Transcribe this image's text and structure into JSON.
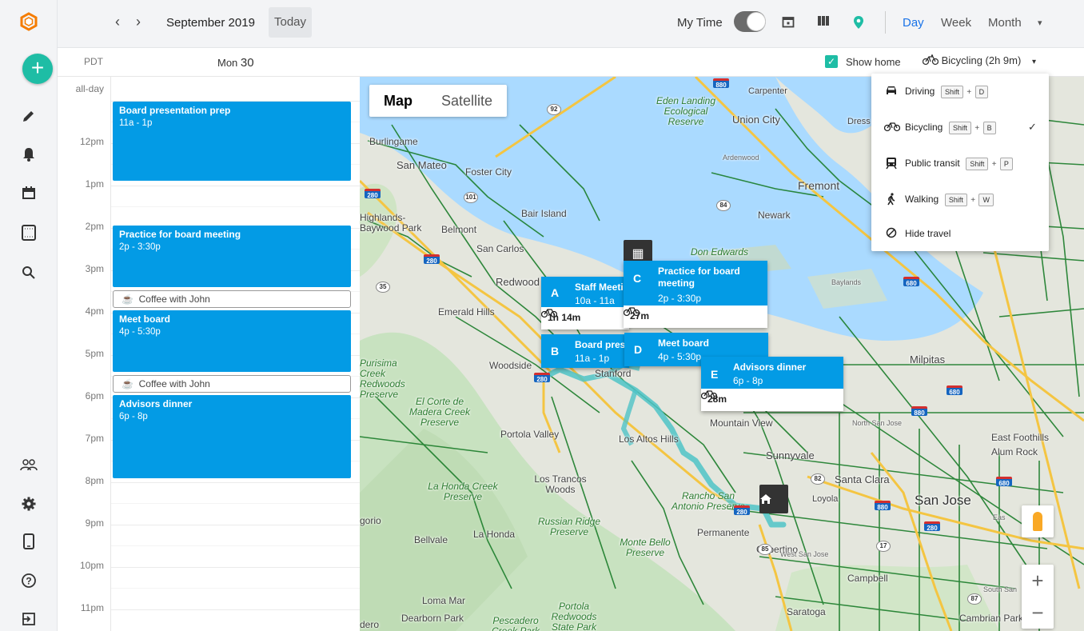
{
  "header": {
    "month": "September 2019",
    "today": "Today",
    "my_time": "My Time",
    "views": [
      "Day",
      "Week",
      "Month"
    ],
    "active_view": "Day",
    "accent": "#1a73e8"
  },
  "subheader": {
    "timezone": "PDT",
    "day_name": "Mon",
    "day_num": "30",
    "show_home": "Show home",
    "travel_mode": "Bicycling (2h 9m)"
  },
  "calendar": {
    "all_day": "all-day",
    "hours": [
      "12pm",
      "1pm",
      "2pm",
      "3pm",
      "4pm",
      "5pm",
      "6pm",
      "7pm",
      "8pm",
      "9pm",
      "10pm",
      "11pm"
    ],
    "events": [
      {
        "title": "Board presentation prep",
        "time": "11a - 1p"
      },
      {
        "title": "Practice for board meeting",
        "time": "2p - 3:30p"
      },
      {
        "title": "Meet board",
        "time": "4p - 5:30p"
      },
      {
        "title": "Advisors dinner",
        "time": "6p - 8p"
      }
    ],
    "travel": [
      "Coffee with John",
      "Coffee with John"
    ]
  },
  "map": {
    "type_map": "Map",
    "type_satellite": "Satellite",
    "places": [
      "Burlingame",
      "San Mateo",
      "Foster City",
      "Bair Island",
      "Belmont",
      "San Carlos",
      "Redwood",
      "Emerald Hills",
      "Woodside",
      "Stanford",
      "Portola Valley",
      "Los Altos Hills",
      "Mountain View",
      "Sunnyvale",
      "Santa Clara",
      "San Jose",
      "Milpitas",
      "Fremont",
      "Newark",
      "Union City",
      "Carpenter",
      "Eden Landing Ecological Reserve",
      "Don Edwards",
      "La Honda",
      "La Honda Creek Preserve",
      "Russian Ridge Preserve",
      "Monte Bello Preserve",
      "Rancho San Antonio Preserve",
      "Permanente",
      "Campbell",
      "Saratoga",
      "Loma Mar",
      "Dearborn Park",
      "Pescadero Creek Park",
      "Portola Redwoods State Park",
      "Los Trancos Woods",
      "Bellvale",
      "Cambrian Park",
      "East Foothills",
      "Alum Rock",
      "Purisima Creek Redwoods Preserve",
      "El Corte de Madera Creek Preserve",
      "Highlands-Baywood Park",
      "Cupertino",
      "Dress",
      "Loyola",
      "West San Jose",
      "North San Jose",
      "Baylands",
      "Ardenwood",
      "gorio",
      "dero",
      "South San",
      "Eas"
    ],
    "highway_shields": [
      "92",
      "880",
      "280",
      "101",
      "84",
      "35",
      "82",
      "85",
      "17",
      "87",
      "680"
    ],
    "cards": [
      {
        "letter": "A",
        "title": "Staff Meeting",
        "time": "10a - 11a",
        "travel": "1h 14m"
      },
      {
        "letter": "B",
        "title": "Board presentation prep",
        "time": "11a - 1p"
      },
      {
        "letter": "C",
        "title": "Practice for board meeting",
        "time": "2p - 3:30p",
        "travel": "27m"
      },
      {
        "letter": "D",
        "title": "Meet board",
        "time": "4p - 5:30p"
      },
      {
        "letter": "E",
        "title": "Advisors dinner",
        "time": "6p - 8p",
        "travel": "28m"
      }
    ]
  },
  "travel_menu": [
    {
      "icon": "car-icon",
      "label": "Driving",
      "key": "D",
      "checked": false
    },
    {
      "icon": "bicycle-icon",
      "label": "Bicycling",
      "key": "B",
      "checked": true
    },
    {
      "icon": "train-icon",
      "label": "Public transit",
      "key": "P",
      "checked": false
    },
    {
      "icon": "walk-icon",
      "label": "Walking",
      "key": "W",
      "checked": false
    },
    {
      "icon": "block-icon",
      "label": "Hide travel",
      "key": null,
      "checked": false
    }
  ],
  "shift_label": "Shift",
  "colors": {
    "event": "#039be5",
    "teal": "#1ebda5",
    "route": "#4fc3c7",
    "bike_paths": "#1b7d2a"
  }
}
